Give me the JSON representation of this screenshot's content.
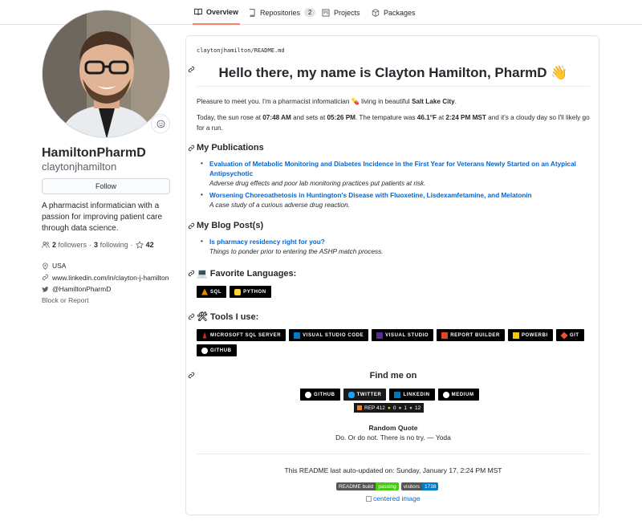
{
  "tabs": [
    {
      "label": "Overview",
      "active": true,
      "icon": "book-icon"
    },
    {
      "label": "Repositories",
      "count": "2",
      "icon": "repo-icon"
    },
    {
      "label": "Projects",
      "icon": "project-icon"
    },
    {
      "label": "Packages",
      "icon": "package-icon"
    }
  ],
  "profile": {
    "fullname": "HamiltonPharmD",
    "username": "claytonjhamilton",
    "follow_label": "Follow",
    "bio": "A pharmacist informatician with a passion for improving patient care through data science.",
    "followers_count": "2",
    "followers_label": "followers",
    "following_count": "3",
    "following_label": "following",
    "stars_count": "42",
    "location": "USA",
    "website": "www.linkedin.com/in/clayton-j-hamilton",
    "twitter": "@HamiltonPharmD",
    "block_label": "Block or Report"
  },
  "readme": {
    "path_user": "claytonjhamilton",
    "path_sep": "/",
    "path_file": "README.md",
    "title": "Hello there, my name is Clayton Hamilton, PharmD 👋",
    "intro_1": "Pleasure to meet you. I'm a pharmacist informatician 💊 living in beautiful ",
    "intro_city": "Salt Lake City",
    "intro_end": ".",
    "weather_1": "Today, the sun rose at ",
    "sunrise": "07:48 AM",
    "weather_2": " and sets at ",
    "sunset": "05:26 PM",
    "weather_3": ". The tempature was ",
    "temp": "46.1°F",
    "weather_4": " at ",
    "temp_time": "2:24 PM MST",
    "weather_5": " and it's a cloudy day so I'll likely go for a run.",
    "pubs_heading": "My Publications",
    "publications": [
      {
        "title": "Evaluation of Metabolic Monitoring and Diabetes Incidence in the First Year for Veterans Newly Started on an Atypical Antipsychotic",
        "desc": "Adverse drug effects and poor lab monitoring practices put patients at risk."
      },
      {
        "title": "Worsening Choreoathetosis in Huntington's Disease with Fluoxetine, Lisdexamfetamine, and Melatonin",
        "desc": "A case study of a curious adverse drug reaction."
      }
    ],
    "blog_heading": "My Blog Post(s)",
    "blog": [
      {
        "title": "Is pharmacy residency right for you?",
        "desc": "Things to ponder prior to entering the ASHP match process."
      }
    ],
    "lang_heading": "💻 Favorite Languages:",
    "languages": [
      {
        "label": "SQL",
        "color": "#e38c00"
      },
      {
        "label": "Python",
        "color": "#ffd43b"
      }
    ],
    "tools_heading": "🛠 Tools I use:",
    "tools": [
      {
        "label": "Microsoft SQL Server",
        "color": "#cc2927"
      },
      {
        "label": "Visual Studio Code",
        "color": "#007acc"
      },
      {
        "label": "Visual Studio",
        "color": "#5c2d91"
      },
      {
        "label": "Report Builder",
        "color": "#e8412a"
      },
      {
        "label": "PowerBI",
        "color": "#f2c811"
      },
      {
        "label": "Git",
        "color": "#f05032"
      },
      {
        "label": "GitHub",
        "color": "#ffffff"
      }
    ],
    "findme_heading": "Find me on",
    "social": [
      {
        "label": "GitHub",
        "bg": "#000000"
      },
      {
        "label": "Twitter",
        "bg": "#1a1a1a"
      },
      {
        "label": "LinkedIn",
        "bg": "#000000"
      },
      {
        "label": "Medium",
        "bg": "#000000"
      }
    ],
    "so_rep": "REP 412",
    "so_gold": "0",
    "so_silver": "1",
    "so_bronze": "12",
    "quote_heading": "Random Quote",
    "quote": "Do. Or do not. There is no try. — Yoda",
    "updated": "This README last auto-updated on: Sunday, January 17, 2:24 PM MST",
    "build_label": "README build",
    "build_status": "passing",
    "visitors_label": "visitors",
    "visitors_count": "1738",
    "img_alt": "centered image"
  }
}
